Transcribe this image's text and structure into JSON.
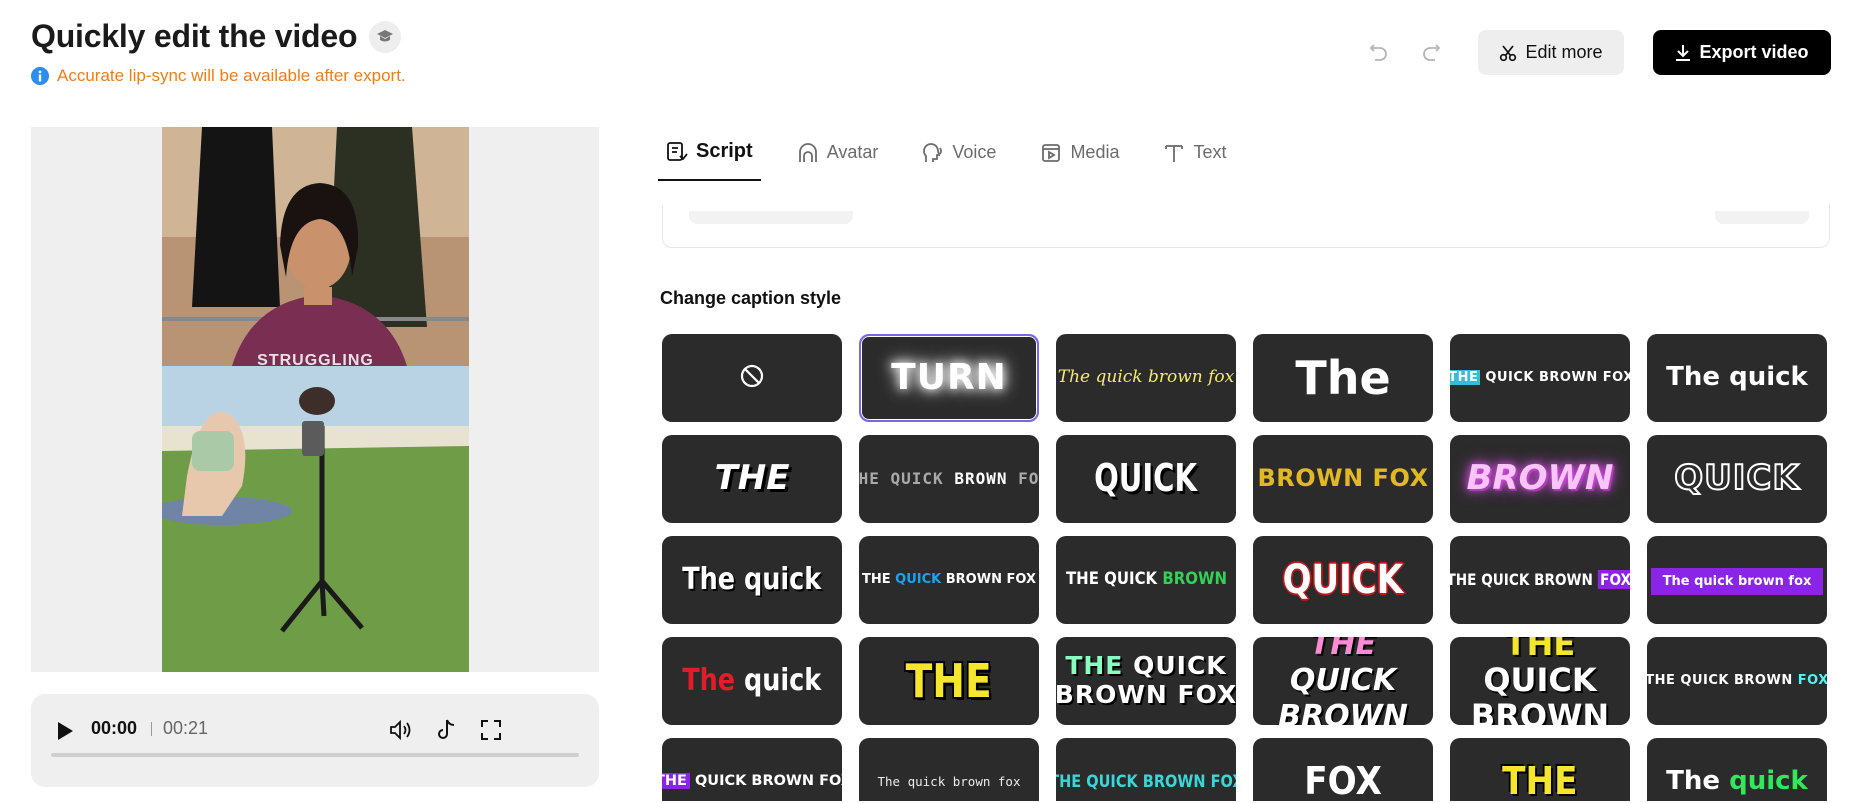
{
  "header": {
    "title": "Quickly edit the video",
    "notice": "Accurate lip-sync will be available after export.",
    "edit_more_label": "Edit more",
    "export_label": "Export video"
  },
  "video": {
    "overlay_caption": "STRUGGLING"
  },
  "player": {
    "current_time": "00:00",
    "total_time": "00:21",
    "progress": 0
  },
  "tabs": [
    {
      "label": "Script",
      "icon": "script-icon",
      "active": true
    },
    {
      "label": "Avatar",
      "icon": "avatar-icon",
      "active": false
    },
    {
      "label": "Voice",
      "icon": "voice-icon",
      "active": false
    },
    {
      "label": "Media",
      "icon": "media-icon",
      "active": false
    },
    {
      "label": "Text",
      "icon": "text-icon",
      "active": false
    }
  ],
  "caption_section": {
    "title": "Change caption style",
    "selected_index": 1,
    "styles": [
      {
        "id": "none",
        "parts": []
      },
      {
        "id": "glow-turn",
        "parts": [
          {
            "t": "TURN"
          }
        ]
      },
      {
        "id": "yellow-italic",
        "parts": [
          {
            "t": "The quick brown fox"
          }
        ]
      },
      {
        "id": "bold-the",
        "parts": [
          {
            "t": "The"
          }
        ]
      },
      {
        "id": "cyan-highlight",
        "parts": [
          {
            "t": "THE",
            "c": "hl-cyan"
          },
          {
            "t": " QUICK BROWN FOX"
          }
        ]
      },
      {
        "id": "bold-the-quick",
        "parts": [
          {
            "t": "The quick"
          }
        ]
      },
      {
        "id": "caps-the",
        "parts": [
          {
            "t": "THE"
          }
        ]
      },
      {
        "id": "mono-gray",
        "parts": [
          {
            "t": "THE QUICK ",
            "c": "c-lightgray"
          },
          {
            "t": "BROWN",
            "c": "c-white"
          },
          {
            "t": " FOX",
            "c": "c-lightgray"
          }
        ]
      },
      {
        "id": "condensed-quick",
        "parts": [
          {
            "t": "QUICK"
          }
        ]
      },
      {
        "id": "gold-brown-fox",
        "parts": [
          {
            "t": "BROWN FOX"
          }
        ]
      },
      {
        "id": "pink-glow-brown",
        "parts": [
          {
            "t": "BROWN"
          }
        ]
      },
      {
        "id": "outline-quick",
        "parts": [
          {
            "t": "QUICK"
          }
        ]
      },
      {
        "id": "condensed-the-quick",
        "parts": [
          {
            "t": "The quick"
          }
        ]
      },
      {
        "id": "blue-quick",
        "parts": [
          {
            "t": "THE "
          },
          {
            "t": "QUICK",
            "c": "c-blue"
          },
          {
            "t": " BROWN FOX"
          }
        ]
      },
      {
        "id": "green-brown",
        "parts": [
          {
            "t": "THE QUICK "
          },
          {
            "t": "BROWN",
            "c": "c-green"
          }
        ]
      },
      {
        "id": "red-outline-quick",
        "parts": [
          {
            "t": "QUICK"
          }
        ]
      },
      {
        "id": "purple-fox",
        "parts": [
          {
            "t": "THE QUICK BROWN "
          },
          {
            "t": "FOX",
            "c": "hl-purple"
          }
        ]
      },
      {
        "id": "purple-box",
        "parts": [
          {
            "t": "The quick brown fox",
            "c": "purple-box"
          }
        ]
      },
      {
        "id": "red-the-quick",
        "parts": [
          {
            "t": "The",
            "c": "c-red"
          },
          {
            "t": " quick"
          }
        ]
      },
      {
        "id": "yellow-the",
        "parts": [
          {
            "t": "THE"
          }
        ]
      },
      {
        "id": "mint-stack",
        "parts": [
          {
            "t": "THE",
            "c": "c-mint"
          },
          {
            "t": " QUICK\nBROWN FOX"
          }
        ]
      },
      {
        "id": "pink-stack",
        "parts": [
          {
            "t": "THE",
            "c": "c-pink"
          },
          {
            "t": "\nQUICK\nBROWN"
          }
        ]
      },
      {
        "id": "yellow-stack",
        "parts": [
          {
            "t": "THE",
            "c": "c-yellow"
          },
          {
            "t": "\nQUICK\nBROWN"
          }
        ]
      },
      {
        "id": "cyan-fox",
        "parts": [
          {
            "t": "THE QUICK BROWN "
          },
          {
            "t": "FOX",
            "c": "c-cyan"
          }
        ]
      },
      {
        "id": "purple-the",
        "parts": [
          {
            "t": "THE",
            "c": "hl-purple"
          },
          {
            "t": " QUICK BROWN FOX"
          }
        ]
      },
      {
        "id": "typewriter",
        "parts": [
          {
            "t": "The quick brown fox"
          }
        ]
      },
      {
        "id": "cyan-condensed",
        "parts": [
          {
            "t": "THE QUICK BROWN FOX"
          }
        ]
      },
      {
        "id": "white-fox",
        "parts": [
          {
            "t": "FOX"
          }
        ]
      },
      {
        "id": "yellow-the-2",
        "parts": [
          {
            "t": "THE"
          }
        ]
      },
      {
        "id": "green-quick",
        "parts": [
          {
            "t": "The "
          },
          {
            "t": "quick",
            "c": "c-green2"
          }
        ]
      }
    ]
  }
}
